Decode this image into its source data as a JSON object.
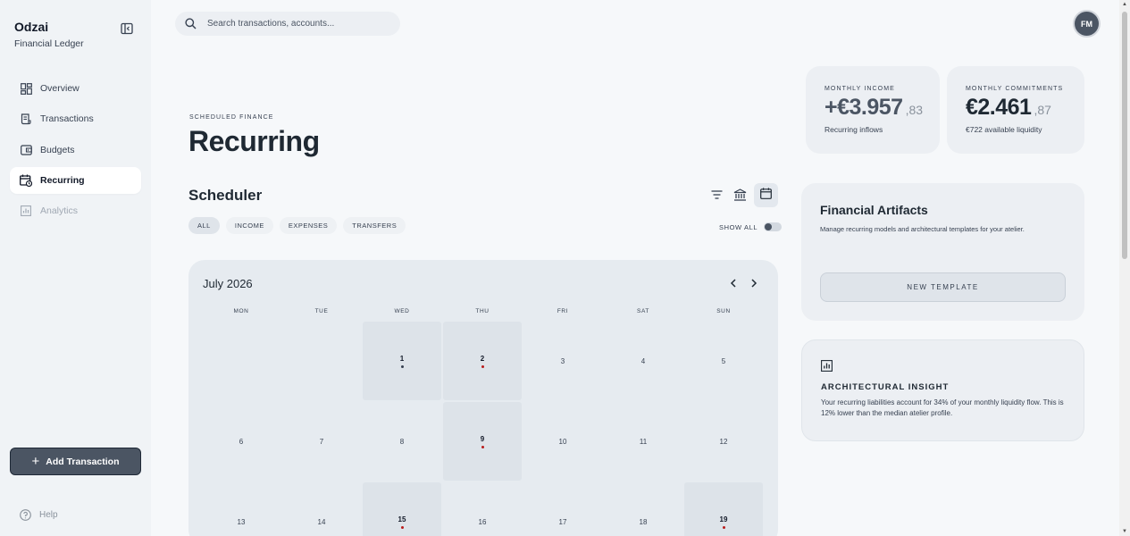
{
  "brand": {
    "name": "Odzai",
    "subtitle": "Financial Ledger"
  },
  "nav": [
    {
      "label": "Overview",
      "icon": "grid-icon"
    },
    {
      "label": "Transactions",
      "icon": "receipt-icon"
    },
    {
      "label": "Budgets",
      "icon": "wallet-icon"
    },
    {
      "label": "Recurring",
      "icon": "calendar-repeat-icon",
      "active": true
    },
    {
      "label": "Analytics",
      "icon": "bar-chart-icon",
      "disabled": true
    }
  ],
  "add_button": "Add Transaction",
  "help": "Help",
  "search": {
    "placeholder": "Search transactions, accounts..."
  },
  "user": {
    "initials": "FM"
  },
  "header": {
    "eyebrow": "SCHEDULED FINANCE",
    "title": "Recurring"
  },
  "stats": {
    "income": {
      "label": "MONTHLY INCOME",
      "value": "+€3.957",
      "cents": ",83",
      "note": "Recurring inflows"
    },
    "commitments": {
      "label": "MONTHLY COMMITMENTS",
      "value": "€2.461",
      "cents": ",87",
      "note": "€722 available liquidity"
    }
  },
  "scheduler": {
    "title": "Scheduler",
    "filters": [
      "ALL",
      "INCOME",
      "EXPENSES",
      "TRANSFERS"
    ],
    "active_filter": "ALL",
    "show_all_label": "SHOW ALL",
    "show_all": false
  },
  "calendar": {
    "month": "July 2026",
    "weekdays": [
      "MON",
      "TUE",
      "WED",
      "THU",
      "FRI",
      "SAT",
      "SUN"
    ],
    "days": [
      {
        "n": "1",
        "col": 2,
        "row": 0,
        "event": "dark"
      },
      {
        "n": "2",
        "col": 3,
        "row": 0,
        "event": "red"
      },
      {
        "n": "3",
        "col": 4,
        "row": 0
      },
      {
        "n": "4",
        "col": 5,
        "row": 0
      },
      {
        "n": "5",
        "col": 6,
        "row": 0
      },
      {
        "n": "6",
        "col": 0,
        "row": 1
      },
      {
        "n": "7",
        "col": 1,
        "row": 1
      },
      {
        "n": "8",
        "col": 2,
        "row": 1
      },
      {
        "n": "9",
        "col": 3,
        "row": 1,
        "event": "red"
      },
      {
        "n": "10",
        "col": 4,
        "row": 1
      },
      {
        "n": "11",
        "col": 5,
        "row": 1
      },
      {
        "n": "12",
        "col": 6,
        "row": 1
      },
      {
        "n": "13",
        "col": 0,
        "row": 2
      },
      {
        "n": "14",
        "col": 1,
        "row": 2
      },
      {
        "n": "15",
        "col": 2,
        "row": 2,
        "event": "red"
      },
      {
        "n": "16",
        "col": 3,
        "row": 2
      },
      {
        "n": "17",
        "col": 4,
        "row": 2
      },
      {
        "n": "18",
        "col": 5,
        "row": 2
      },
      {
        "n": "19",
        "col": 6,
        "row": 2,
        "event": "red"
      }
    ]
  },
  "colors": {
    "event_red": "#b91c1c",
    "event_dark": "#374151",
    "accent": "#4b5563"
  },
  "artifacts": {
    "title": "Financial Artifacts",
    "description": "Manage recurring models and architectural templates for your atelier.",
    "button": "NEW TEMPLATE"
  },
  "insight": {
    "icon": "chart-icon",
    "title": "ARCHITECTURAL INSIGHT",
    "text": "Your recurring liabilities account for 34% of your monthly liquidity flow. This is 12% lower than the median atelier profile."
  }
}
